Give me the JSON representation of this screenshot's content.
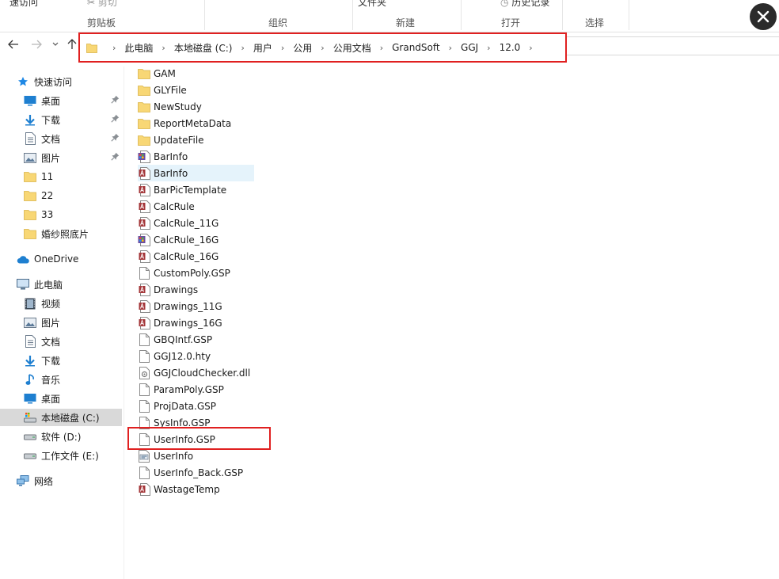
{
  "ribbon": {
    "top_items": [
      "速访问",
      "剪切",
      "文件夹",
      "历史记录"
    ],
    "groups": [
      "剪贴板",
      "组织",
      "新建",
      "打开",
      "选择"
    ]
  },
  "address": {
    "crumbs": [
      "此电脑",
      "本地磁盘 (C:)",
      "用户",
      "公用",
      "公用文档",
      "GrandSoft",
      "GGJ",
      "12.0"
    ]
  },
  "sidebar": {
    "items": [
      {
        "label": "快速访问",
        "icon": "star-icon",
        "level": 1,
        "pinned": false
      },
      {
        "label": "桌面",
        "icon": "desktop-icon",
        "level": 2,
        "pinned": true
      },
      {
        "label": "下载",
        "icon": "download-icon",
        "level": 2,
        "pinned": true
      },
      {
        "label": "文档",
        "icon": "document-icon",
        "level": 2,
        "pinned": true
      },
      {
        "label": "图片",
        "icon": "picture-icon",
        "level": 2,
        "pinned": true
      },
      {
        "label": "11",
        "icon": "folder-icon",
        "level": 2,
        "pinned": false
      },
      {
        "label": "22",
        "icon": "folder-icon",
        "level": 2,
        "pinned": false
      },
      {
        "label": "33",
        "icon": "folder-icon",
        "level": 2,
        "pinned": false
      },
      {
        "label": "婚纱照底片",
        "icon": "folder-icon",
        "level": 2,
        "pinned": false
      },
      {
        "label": "OneDrive",
        "icon": "cloud-icon",
        "level": 1,
        "pinned": false
      },
      {
        "label": "此电脑",
        "icon": "computer-icon",
        "level": 1,
        "pinned": false
      },
      {
        "label": "视频",
        "icon": "video-icon",
        "level": 2,
        "pinned": false
      },
      {
        "label": "图片",
        "icon": "picture-icon",
        "level": 2,
        "pinned": false
      },
      {
        "label": "文档",
        "icon": "document-icon",
        "level": 2,
        "pinned": false
      },
      {
        "label": "下载",
        "icon": "download-icon",
        "level": 2,
        "pinned": false
      },
      {
        "label": "音乐",
        "icon": "music-icon",
        "level": 2,
        "pinned": false
      },
      {
        "label": "桌面",
        "icon": "desktop-icon",
        "level": 2,
        "pinned": false
      },
      {
        "label": "本地磁盘 (C:)",
        "icon": "drive-c-icon",
        "level": 2,
        "pinned": false,
        "selected": true
      },
      {
        "label": "软件 (D:)",
        "icon": "drive-icon",
        "level": 2,
        "pinned": false
      },
      {
        "label": "工作文件 (E:)",
        "icon": "drive-icon",
        "level": 2,
        "pinned": false
      },
      {
        "label": "网络",
        "icon": "network-icon",
        "level": 1,
        "pinned": false
      }
    ]
  },
  "files": [
    {
      "name": "GAM",
      "icon": "folder-icon"
    },
    {
      "name": "GLYFile",
      "icon": "folder-icon"
    },
    {
      "name": "NewStudy",
      "icon": "folder-icon"
    },
    {
      "name": "ReportMetaData",
      "icon": "folder-icon"
    },
    {
      "name": "UpdateFile",
      "icon": "folder-icon"
    },
    {
      "name": "BarInfo",
      "icon": "app-file-icon"
    },
    {
      "name": "BarInfo",
      "icon": "access-file-icon",
      "hover": true
    },
    {
      "name": "BarPicTemplate",
      "icon": "access-file-icon"
    },
    {
      "name": "CalcRule",
      "icon": "access-file-icon"
    },
    {
      "name": "CalcRule_11G",
      "icon": "access-file-icon"
    },
    {
      "name": "CalcRule_16G",
      "icon": "app-file-icon"
    },
    {
      "name": "CalcRule_16G",
      "icon": "access-file-icon"
    },
    {
      "name": "CustomPoly.GSP",
      "icon": "blank-file-icon"
    },
    {
      "name": "Drawings",
      "icon": "access-file-icon"
    },
    {
      "name": "Drawings_11G",
      "icon": "access-file-icon"
    },
    {
      "name": "Drawings_16G",
      "icon": "access-file-icon"
    },
    {
      "name": "GBQIntf.GSP",
      "icon": "blank-file-icon"
    },
    {
      "name": "GGJ12.0.hty",
      "icon": "blank-file-icon"
    },
    {
      "name": "GGJCloudChecker.dll",
      "icon": "dll-file-icon"
    },
    {
      "name": "ParamPoly.GSP",
      "icon": "blank-file-icon"
    },
    {
      "name": "ProjData.GSP",
      "icon": "blank-file-icon"
    },
    {
      "name": "SysInfo.GSP",
      "icon": "blank-file-icon"
    },
    {
      "name": "UserInfo.GSP",
      "icon": "blank-file-icon",
      "highlighted": true
    },
    {
      "name": "UserInfo",
      "icon": "config-file-icon"
    },
    {
      "name": "UserInfo_Back.GSP",
      "icon": "blank-file-icon"
    },
    {
      "name": "WastageTemp",
      "icon": "access-file-icon"
    }
  ],
  "colors": {
    "highlight": "#e02020",
    "folder": "#f8d775",
    "selection": "#d9d9d9",
    "hover": "#e5f3fb"
  }
}
